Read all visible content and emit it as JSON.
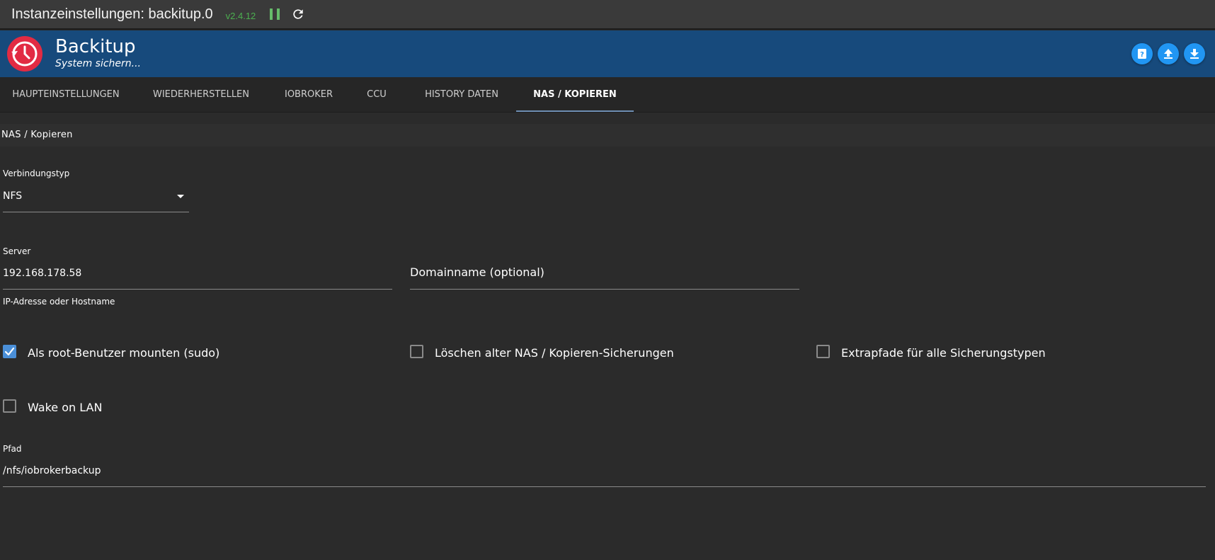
{
  "titlebar": {
    "title": "Instanzeinstellungen: backitup.0",
    "version": "v2.4.12",
    "icons": [
      "pause-icon",
      "refresh-icon"
    ]
  },
  "header": {
    "title": "Backitup",
    "subtitle": "System sichern...",
    "actions": [
      "help-icon",
      "upload-icon",
      "download-icon"
    ]
  },
  "tabs": [
    {
      "label": "HAUPTEINSTELLUNGEN",
      "active": false
    },
    {
      "label": "WIEDERHERSTELLEN",
      "active": false
    },
    {
      "label": "IOBROKER",
      "active": false
    },
    {
      "label": "CCU",
      "active": false
    },
    {
      "label": "HISTORY DATEN",
      "active": false
    },
    {
      "label": "NAS / KOPIEREN",
      "active": true
    }
  ],
  "section": {
    "title": "NAS / Kopieren"
  },
  "form": {
    "connection_type": {
      "label": "Verbindungstyp",
      "value": "NFS"
    },
    "server": {
      "label": "Server",
      "value": "192.168.178.58",
      "helper": "IP-Adresse oder Hostname"
    },
    "domain": {
      "placeholder": "Domainname (optional)"
    },
    "checkboxes": {
      "sudo": {
        "label": "Als root-Benutzer mounten (sudo)",
        "checked": true
      },
      "delete_old": {
        "label": "Löschen alter NAS / Kopieren-Sicherungen",
        "checked": false
      },
      "extra_paths": {
        "label": "Extrapfade für alle Sicherungstypen",
        "checked": false
      },
      "wake_on_lan": {
        "label": "Wake on LAN",
        "checked": false
      }
    },
    "path": {
      "label": "Pfad",
      "value": "/nfs/iobrokerbackup"
    }
  },
  "colors": {
    "header_blue": "#174a7c",
    "accent_blue": "#2196f3",
    "logo_red": "#e22b43",
    "version_green": "#4caf50",
    "checkbox_checked": "#4a8fd8"
  }
}
